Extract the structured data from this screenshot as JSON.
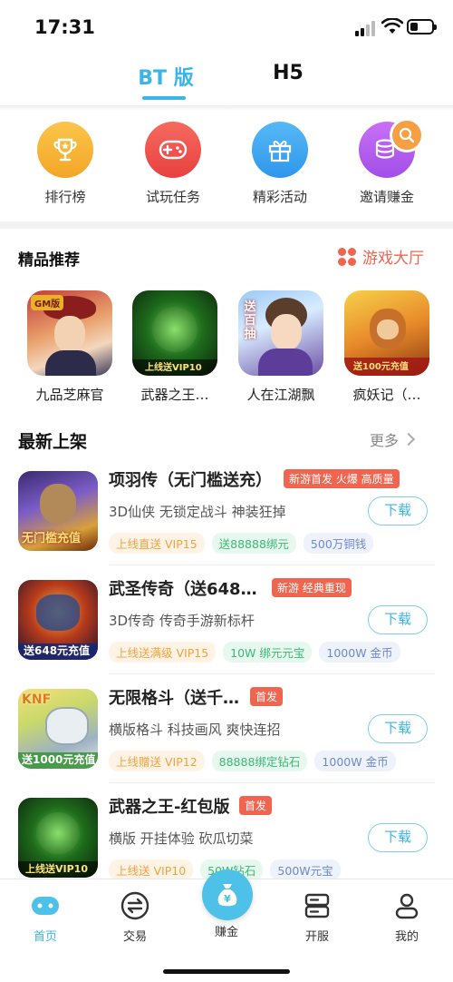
{
  "status_bar": {
    "time": "17:31"
  },
  "top_tabs": [
    {
      "label": "BT 版",
      "active": true
    },
    {
      "label": "H5",
      "active": false
    }
  ],
  "quick_actions": [
    {
      "label": "排行榜",
      "icon": "trophy-icon",
      "color": "#f7b536"
    },
    {
      "label": "试玩任务",
      "icon": "gamepad-icon",
      "color": "#f04e4e"
    },
    {
      "label": "精彩活动",
      "icon": "gift-icon",
      "color": "#3aa8f0"
    },
    {
      "label": "邀请赚金",
      "icon": "coins-icon",
      "color": "#b65cf0"
    }
  ],
  "featured_section": {
    "title": "精品推荐",
    "hall_link": "游戏大厅"
  },
  "featured_games": [
    {
      "title": "九品芝麻官",
      "badge": "GM版"
    },
    {
      "title": "武器之王…",
      "badge": "上线送VIP10"
    },
    {
      "title": "人在江湖飘",
      "badge": "送百抽"
    },
    {
      "title": "疯妖记（…",
      "badge": "送100元充值"
    }
  ],
  "new_section": {
    "title": "最新上架",
    "more": "更多"
  },
  "new_games": [
    {
      "name": "项羽传（无门槛送充）",
      "tag": "新游首发 火爆 高质量",
      "desc": "3D仙侠 无锁定战斗 神装狂掉",
      "download": "下载",
      "chips": [
        "上线直送 VIP15",
        "送88888绑元",
        "500万铜钱"
      ],
      "thumb_text": "无门槛充值"
    },
    {
      "name": "武圣传奇（送648…",
      "tag": "新游 经典重现",
      "desc": "3D传奇 传奇手游新标杆",
      "download": "下载",
      "chips": [
        "上线送满级 VIP15",
        "10W 绑元元宝",
        "1000W 金币"
      ],
      "thumb_text": "送648元充值"
    },
    {
      "name": "无限格斗（送千…",
      "tag": "首发",
      "desc": "横版格斗 科技画风 爽快连招",
      "download": "下载",
      "chips": [
        "上线赠送 VIP12",
        "88888绑定钻石",
        "1000W 金币"
      ],
      "thumb_text": "送1000元充值"
    },
    {
      "name": "武器之王-红包版",
      "tag": "首发",
      "desc": "横版 开挂体验 砍瓜切菜",
      "download": "下载",
      "chips": [
        "上线送 VIP10",
        "50W钻石",
        "500W元宝"
      ],
      "thumb_text": "上线送VIP10"
    }
  ],
  "bottom_nav": [
    {
      "label": "首页",
      "icon": "home-gamepad-icon",
      "active": true
    },
    {
      "label": "交易",
      "icon": "exchange-icon",
      "active": false
    },
    {
      "label": "赚金",
      "icon": "money-bag-icon",
      "active": false
    },
    {
      "label": "开服",
      "icon": "server-icon",
      "active": false
    },
    {
      "label": "我的",
      "icon": "profile-icon",
      "active": false
    }
  ]
}
